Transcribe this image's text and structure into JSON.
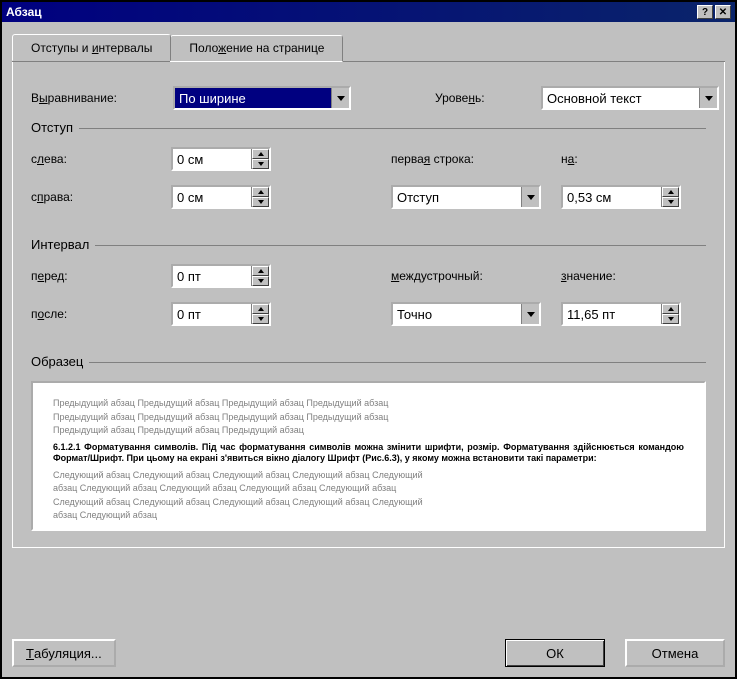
{
  "title": "Абзац",
  "tabs": {
    "tab1": "Отступы и интервалы",
    "tab2": "Положение на странице"
  },
  "alignment": {
    "label_prefix": "В",
    "label_underline": "ы",
    "label_suffix": "равнивание:",
    "value": "По ширине"
  },
  "level": {
    "label_prefix": "Урове",
    "label_underline": "н",
    "label_suffix": "ь:",
    "value": "Основной текст"
  },
  "indent": {
    "legend": "Отступ",
    "left_label_prefix": "с",
    "left_label_underline": "л",
    "left_label_suffix": "ева:",
    "left_value": "0 см",
    "right_label_prefix": "с",
    "right_label_underline": "п",
    "right_label_suffix": "рава:",
    "right_value": "0 см",
    "firstline_label_prefix": "перва",
    "firstline_label_underline": "я",
    "firstline_label_suffix": " строка:",
    "firstline_value": "Отступ",
    "by_label_prefix": "н",
    "by_label_underline": "а",
    "by_label_suffix": ":",
    "by_value": "0,53 см"
  },
  "spacing": {
    "legend": "Интервал",
    "before_label_prefix": "п",
    "before_label_underline": "е",
    "before_label_suffix": "ред:",
    "before_value": "0 пт",
    "after_label_prefix": "п",
    "after_label_underline": "о",
    "after_label_suffix": "сле:",
    "after_value": "0 пт",
    "line_label_prefix": "",
    "line_label_underline": "м",
    "line_label_suffix": "еждустрочный:",
    "line_value": "Точно",
    "at_label_prefix": "",
    "at_label_underline": "з",
    "at_label_suffix": "начение:",
    "at_value": "11,65 пт"
  },
  "preview": {
    "legend": "Образец",
    "grey1": "Предыдущий абзац Предыдущий абзац Предыдущий абзац Предыдущий абзац",
    "grey2": "Предыдущий абзац Предыдущий абзац Предыдущий абзац Предыдущий абзац",
    "grey3": "Предыдущий абзац Предыдущий абзац Предыдущий абзац",
    "main": "6.1.2.1 Форматування символів. Під час форматування символів можна змінити шрифти, розмір. Форматування здійснюється командою Формат/Шрифт. При цьому на екрані з'явиться вікно діалогу Шрифт (Рис.6.3), у якому можна встановити такі параметри:",
    "grey4": "Следующий абзац Следующий абзац Следующий абзац Следующий абзац Следующий",
    "grey5": "абзац Следующий абзац Следующий абзац Следующий абзац Следующий абзац",
    "grey6": "Следующий абзац Следующий абзац Следующий абзац Следующий абзац Следующий",
    "grey7": "абзац Следующий абзац"
  },
  "buttons": {
    "tabs_prefix": "",
    "tabs_underline": "Т",
    "tabs_suffix": "абуляция...",
    "ok": "ОК",
    "cancel": "Отмена"
  }
}
